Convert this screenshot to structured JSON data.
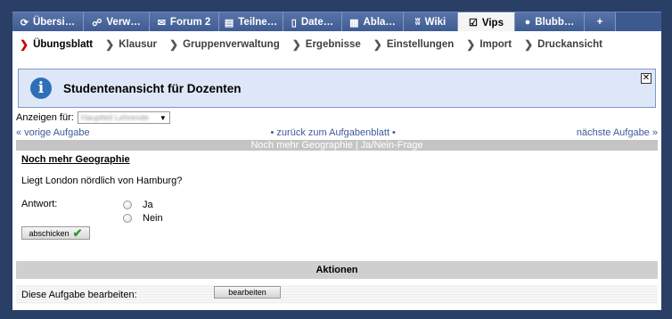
{
  "tabs": [
    {
      "icon": "⟳",
      "icon_name": "overview-icon",
      "label": "Übersi…"
    },
    {
      "icon": "☍",
      "icon_name": "manage-icon",
      "label": "Verw…"
    },
    {
      "icon": "✉",
      "icon_name": "forum-icon",
      "label": "Forum 2"
    },
    {
      "icon": "▤",
      "icon_name": "participants-icon",
      "label": "Teilne…"
    },
    {
      "icon": "▯",
      "icon_name": "files-icon",
      "label": "Date…"
    },
    {
      "icon": "▦",
      "icon_name": "schedule-icon",
      "label": "Abla…"
    },
    {
      "icon": "ʬ",
      "icon_name": "wiki-icon",
      "label": "Wiki"
    },
    {
      "icon": "☑",
      "icon_name": "vips-icon",
      "label": "Vips",
      "active": true
    },
    {
      "icon": "●",
      "icon_name": "blubber-icon",
      "label": "Blubb…"
    },
    {
      "icon": "",
      "icon_name": "",
      "label": "+"
    }
  ],
  "subnav": [
    {
      "label": "Übungsblatt",
      "active": true
    },
    {
      "label": "Klausur"
    },
    {
      "label": "Gruppenverwaltung"
    },
    {
      "label": "Ergebnisse"
    },
    {
      "label": "Einstellungen"
    },
    {
      "label": "Import"
    },
    {
      "label": "Druckansicht"
    }
  ],
  "info": {
    "text": "Studentenansicht für Dozenten",
    "close": "✕"
  },
  "filter": {
    "label": "Anzeigen für:",
    "selected": "Hauptteil Lehrende"
  },
  "nav": {
    "prev": "« vorige Aufgabe",
    "back": "• zurück zum Aufgabenblatt •",
    "next": "nächste Aufgabe »"
  },
  "assignment_header": "Noch mehr Geographie | Ja/Nein-Frage",
  "question": {
    "title": "Noch mehr Geographie",
    "text": "Liegt London nördlich von Hamburg?",
    "answer_label": "Antwort:",
    "options": [
      "Ja",
      "Nein"
    ],
    "submit": "abschicken"
  },
  "actions": {
    "header": "Aktionen",
    "edit_label": "Diese Aufgabe bearbeiten:",
    "edit_button": "bearbeiten"
  },
  "colors": {
    "background": "#2a3f66",
    "accent": "#3c5a99",
    "info": "#dde7f8"
  }
}
